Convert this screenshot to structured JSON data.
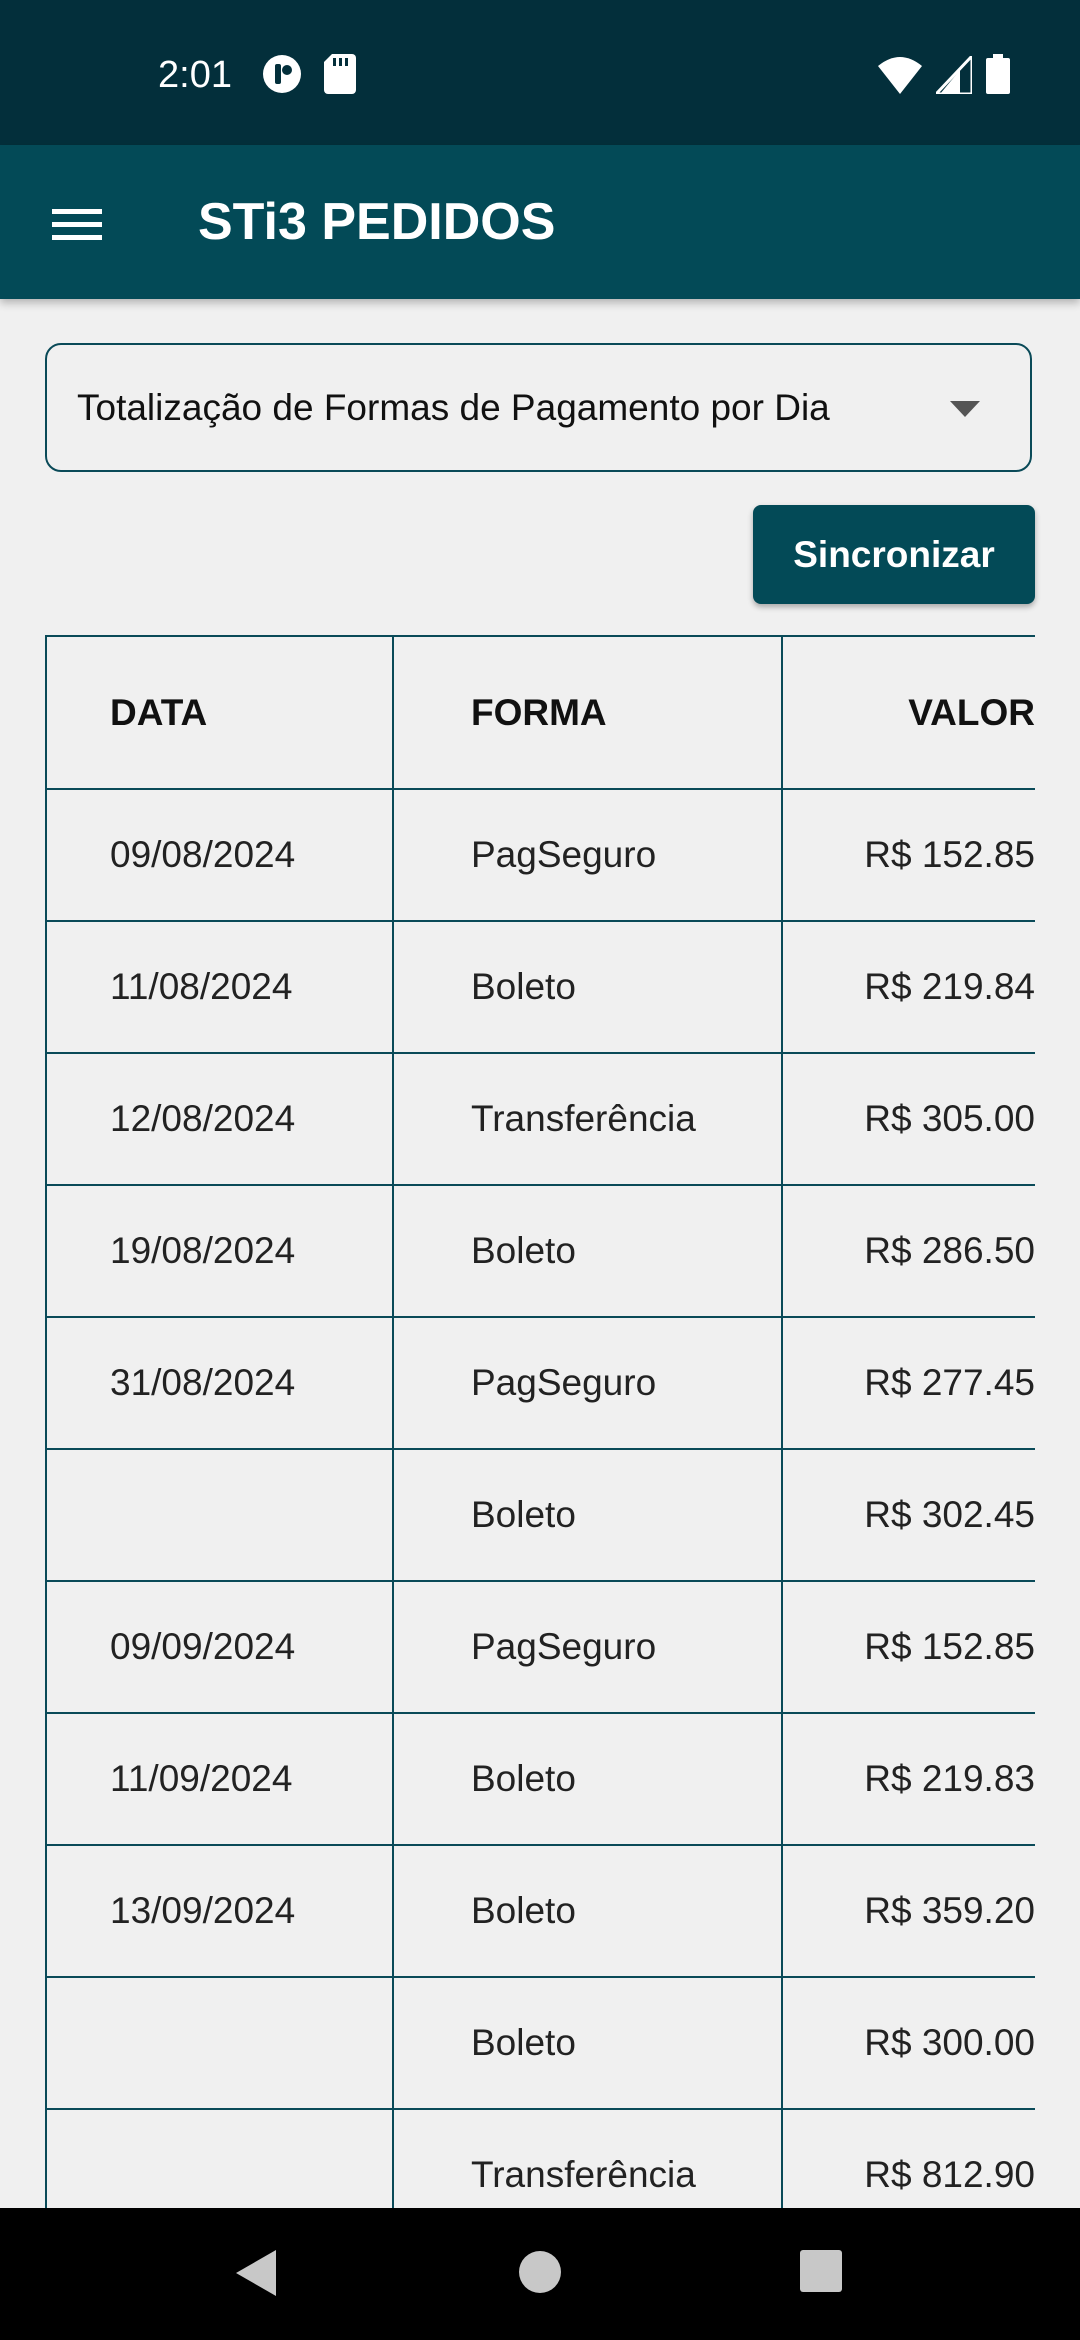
{
  "status_bar": {
    "time": "2:01",
    "icons_left": [
      "podcast-icon",
      "sd-card-icon"
    ],
    "icons_right": [
      "wifi-icon",
      "signal-icon",
      "battery-icon"
    ]
  },
  "app_bar": {
    "title": "STi3 PEDIDOS",
    "menu_icon": "hamburger-menu-icon"
  },
  "report_select": {
    "selected": "Totalização de Formas de Pagamento por Dia",
    "icon": "dropdown-caret-icon"
  },
  "sync_button": {
    "label": "Sincronizar"
  },
  "table": {
    "headers": [
      "DATA",
      "FORMA",
      "VALOR"
    ],
    "rows": [
      {
        "data": "09/08/2024",
        "forma": "PagSeguro",
        "valor": "R$ 152.85"
      },
      {
        "data": "11/08/2024",
        "forma": "Boleto",
        "valor": "R$ 219.84"
      },
      {
        "data": "12/08/2024",
        "forma": "Transferência",
        "valor": "R$ 305.00"
      },
      {
        "data": "19/08/2024",
        "forma": "Boleto",
        "valor": "R$ 286.50"
      },
      {
        "data": "31/08/2024",
        "forma": "PagSeguro",
        "valor": "R$ 277.45"
      },
      {
        "data": "",
        "forma": "Boleto",
        "valor": "R$ 302.45"
      },
      {
        "data": "09/09/2024",
        "forma": "PagSeguro",
        "valor": "R$ 152.85"
      },
      {
        "data": "11/09/2024",
        "forma": "Boleto",
        "valor": "R$ 219.83"
      },
      {
        "data": "13/09/2024",
        "forma": "Boleto",
        "valor": "R$ 359.20"
      },
      {
        "data": "",
        "forma": "Boleto",
        "valor": "R$ 300.00"
      },
      {
        "data": "",
        "forma": "Transferência",
        "valor": "R$ 812.90"
      }
    ]
  },
  "nav_bar": {
    "back_icon": "back-triangle-icon",
    "home_icon": "home-circle-icon",
    "recents_icon": "recents-square-icon"
  },
  "colors": {
    "status_bar": "#032f3b",
    "app_bar": "#034a57",
    "accent": "#034a57",
    "border": "#0a4a58",
    "background": "#f0f0f0"
  }
}
